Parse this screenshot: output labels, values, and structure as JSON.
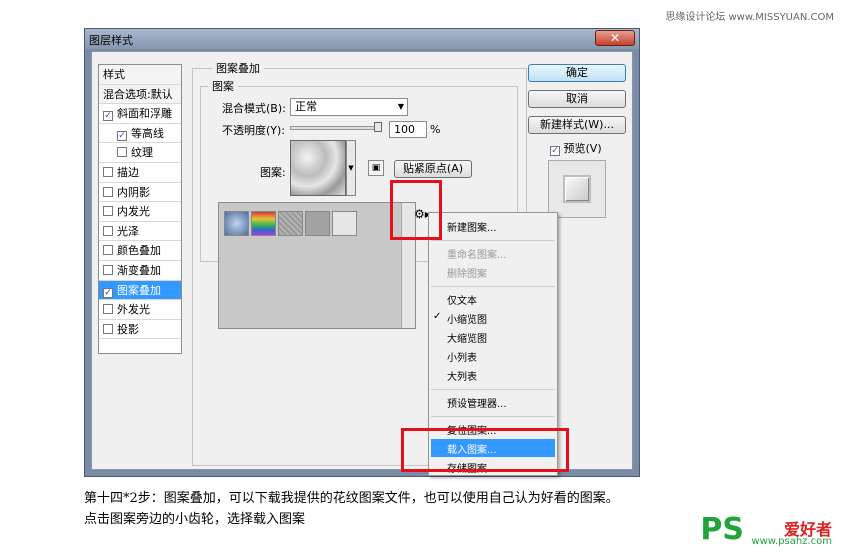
{
  "watermark_top": "思缘设计论坛 www.MISSYUAN.COM",
  "window": {
    "title": "图层样式",
    "close_label": "✕"
  },
  "styles_list": {
    "header_label": "样式",
    "blend_label": "混合选项:默认",
    "items": [
      {
        "label": "斜面和浮雕",
        "checked": true,
        "indent": false,
        "selected": false
      },
      {
        "label": "等高线",
        "checked": true,
        "indent": true,
        "selected": false
      },
      {
        "label": "纹理",
        "checked": false,
        "indent": true,
        "selected": false
      },
      {
        "label": "描边",
        "checked": false,
        "indent": false,
        "selected": false
      },
      {
        "label": "内阴影",
        "checked": false,
        "indent": false,
        "selected": false
      },
      {
        "label": "内发光",
        "checked": false,
        "indent": false,
        "selected": false
      },
      {
        "label": "光泽",
        "checked": false,
        "indent": false,
        "selected": false
      },
      {
        "label": "颜色叠加",
        "checked": false,
        "indent": false,
        "selected": false
      },
      {
        "label": "渐变叠加",
        "checked": false,
        "indent": false,
        "selected": false
      },
      {
        "label": "图案叠加",
        "checked": true,
        "indent": false,
        "selected": true
      },
      {
        "label": "外发光",
        "checked": false,
        "indent": false,
        "selected": false
      },
      {
        "label": "投影",
        "checked": false,
        "indent": false,
        "selected": false
      }
    ]
  },
  "panel": {
    "group_title": "图案叠加",
    "subgroup_title": "图案",
    "blend_mode_label": "混合模式(B):",
    "blend_mode_value": "正常",
    "opacity_label": "不透明度(Y):",
    "opacity_value": "100",
    "opacity_unit": "%",
    "opacity_level": 1.0,
    "pattern_label": "图案:",
    "snap_button": "贴紧原点(A)"
  },
  "right_buttons": {
    "ok": "确定",
    "cancel": "取消",
    "new_style": "新建样式(W)...",
    "preview_label": "预览(V)",
    "preview_checked": true
  },
  "menu": {
    "items": [
      {
        "label": "新建图案...",
        "disabled": false,
        "checked": false,
        "highlighted": false
      },
      {
        "label": "重命名图案...",
        "disabled": true,
        "checked": false,
        "highlighted": false
      },
      {
        "label": "删除图案",
        "disabled": true,
        "checked": false,
        "highlighted": false
      },
      {
        "label": "仅文本",
        "disabled": false,
        "checked": false,
        "highlighted": false
      },
      {
        "label": "小缩览图",
        "disabled": false,
        "checked": true,
        "highlighted": false
      },
      {
        "label": "大缩览图",
        "disabled": false,
        "checked": false,
        "highlighted": false
      },
      {
        "label": "小列表",
        "disabled": false,
        "checked": false,
        "highlighted": false
      },
      {
        "label": "大列表",
        "disabled": false,
        "checked": false,
        "highlighted": false
      },
      {
        "label": "预设管理器...",
        "disabled": false,
        "checked": false,
        "highlighted": false
      },
      {
        "label": "复位图案...",
        "disabled": false,
        "checked": false,
        "highlighted": false
      },
      {
        "label": "载入图案...",
        "disabled": false,
        "checked": false,
        "highlighted": true
      },
      {
        "label": "存储图案...",
        "disabled": false,
        "checked": false,
        "highlighted": false
      }
    ]
  },
  "caption": {
    "line1": "第十四*2步：图案叠加，可以下载我提供的花纹图案文件，也可以使用自己认为好看的图案。",
    "line2": "点击图案旁边的小齿轮，选择载入图案"
  },
  "logo": {
    "ps": "PS",
    "cn": "爱好者",
    "url": "www.psahz.com"
  },
  "colors": {
    "selection": "#3399ff",
    "highlight_box": "#e2111a",
    "logo_green": "#22a33c"
  }
}
